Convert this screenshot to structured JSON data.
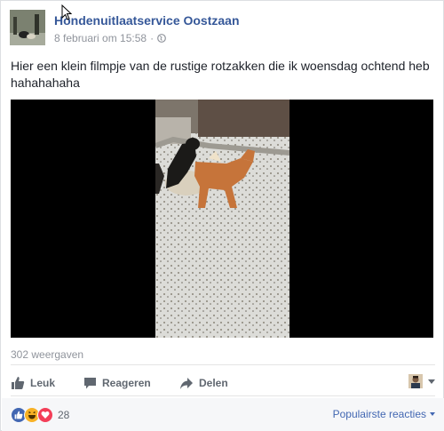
{
  "post": {
    "page_name": "Hondenuitlaatservice Oostzaan",
    "timestamp": "8 februari om 15:58",
    "separator": "·",
    "privacy_icon": "globe-icon",
    "text": "Hier een klein filmpje van de rustige rotzakken die ik woensdag ochtend heb hahahahaha"
  },
  "video": {
    "views": "302 weergaven"
  },
  "actions": {
    "like_label": "Leuk",
    "comment_label": "Reageren",
    "share_label": "Delen"
  },
  "footer": {
    "reaction_icons": [
      "like-icon",
      "haha-icon",
      "love-icon"
    ],
    "reaction_count": "28",
    "top_reactions_label": "Populairste reacties"
  },
  "colors": {
    "link_blue": "#365899",
    "like_blue": "#4267b2",
    "muted": "#90949c",
    "love_red": "#f33e58",
    "haha_yellow": "#f7b125"
  }
}
